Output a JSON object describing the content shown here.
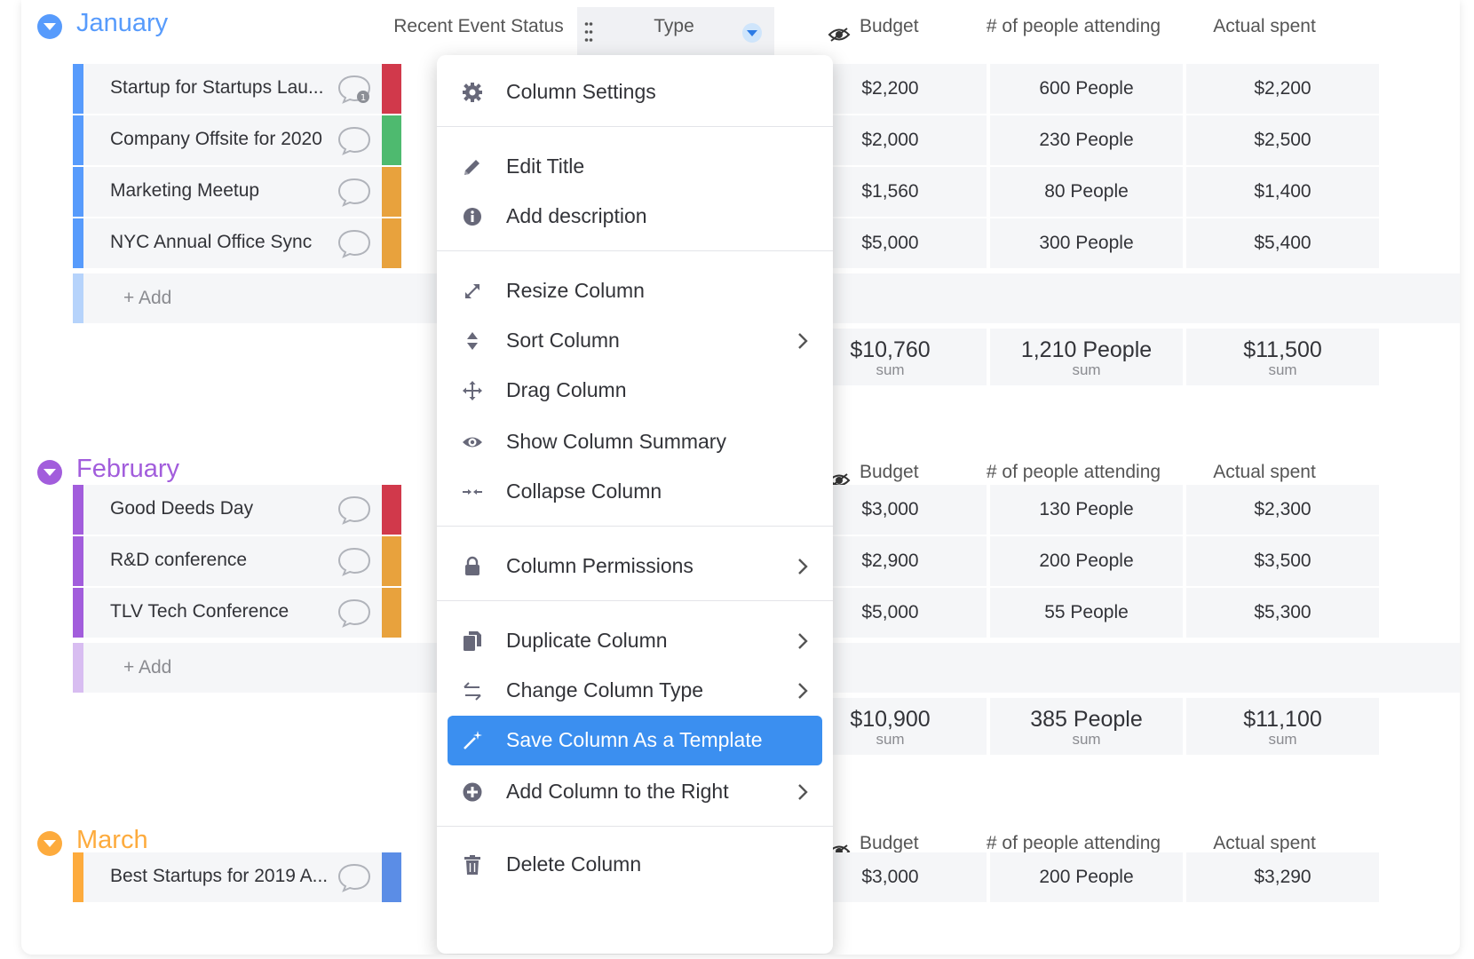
{
  "columns": {
    "status": "Recent Event Status",
    "type": "Type",
    "budget": "Budget",
    "people": "# of people attending",
    "spent": "Actual spent"
  },
  "add_label": "+ Add",
  "sum_label": "sum",
  "colors": {
    "january": "#579bfc",
    "february": "#a25ddc",
    "march": "#fdab3d",
    "red": "#d1394b",
    "green": "#4eba6f",
    "orange": "#e8a23d",
    "blue": "#5b8de6",
    "menu_active": "#3b8ff0"
  },
  "groups": [
    {
      "title": "January",
      "rows": [
        {
          "name": "Startup for Startups Lau...",
          "comments": "1",
          "budget": "$2,200",
          "people": "600 People",
          "spent": "$2,200"
        },
        {
          "name": "Company Offsite for 2020",
          "comments": "",
          "budget": "$2,000",
          "people": "230 People",
          "spent": "$2,500"
        },
        {
          "name": "Marketing Meetup",
          "comments": "",
          "budget": "$1,560",
          "people": "80 People",
          "spent": "$1,400"
        },
        {
          "name": "NYC Annual Office Sync",
          "comments": "",
          "budget": "$5,000",
          "people": "300 People",
          "spent": "$5,400"
        }
      ],
      "sums": {
        "budget": "$10,760",
        "people": "1,210 People",
        "spent": "$11,500"
      }
    },
    {
      "title": "February",
      "rows": [
        {
          "name": "Good Deeds Day",
          "comments": "",
          "budget": "$3,000",
          "people": "130 People",
          "spent": "$2,300"
        },
        {
          "name": "R&D conference",
          "comments": "",
          "budget": "$2,900",
          "people": "200 People",
          "spent": "$3,500"
        },
        {
          "name": "TLV Tech Conference",
          "comments": "",
          "budget": "$5,000",
          "people": "55 People",
          "spent": "$5,300"
        }
      ],
      "sums": {
        "budget": "$10,900",
        "people": "385 People",
        "spent": "$11,100"
      }
    },
    {
      "title": "March",
      "rows": [
        {
          "name": "Best Startups for 2019 A...",
          "comments": "",
          "budget": "$3,000",
          "people": "200 People",
          "spent": "$3,290"
        }
      ]
    }
  ],
  "menu": {
    "items": [
      {
        "label": "Column Settings",
        "icon": "gear-icon"
      },
      {
        "label": "Edit Title",
        "icon": "pencil-icon"
      },
      {
        "label": "Add description",
        "icon": "info-icon"
      },
      {
        "label": "Resize Column",
        "icon": "resize-icon"
      },
      {
        "label": "Sort Column",
        "icon": "sort-icon",
        "submenu": true
      },
      {
        "label": "Drag Column",
        "icon": "move-icon"
      },
      {
        "label": "Show Column Summary",
        "icon": "eye-icon"
      },
      {
        "label": "Collapse Column",
        "icon": "collapse-icon"
      },
      {
        "label": "Column Permissions",
        "icon": "lock-icon",
        "submenu": true
      },
      {
        "label": "Duplicate Column",
        "icon": "duplicate-icon",
        "submenu": true
      },
      {
        "label": "Change Column Type",
        "icon": "swap-icon",
        "submenu": true
      },
      {
        "label": "Save Column As a Template",
        "icon": "magic-wand-icon",
        "active": true
      },
      {
        "label": "Add Column to the Right",
        "icon": "plus-circle-icon",
        "submenu": true
      },
      {
        "label": "Delete Column",
        "icon": "trash-icon"
      }
    ]
  }
}
